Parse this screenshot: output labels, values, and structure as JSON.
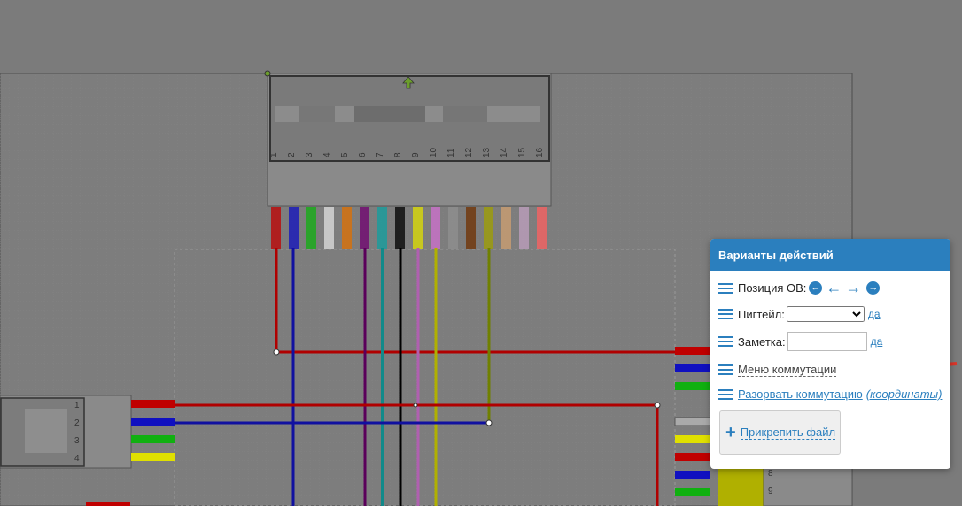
{
  "popup": {
    "title": "Варианты действий",
    "position_label": "Позиция ОВ:",
    "pigtail_label": "Пигтейл:",
    "pigtail_selected": "",
    "pigtail_confirm": "да",
    "note_label": "Заметка:",
    "note_value": "",
    "note_confirm": "да",
    "switch_menu": "Меню коммутации",
    "break_switch": "Разорвать коммутацию",
    "coords": "(координаты)",
    "attach_file": "Прикрепить файл"
  },
  "connector_top": {
    "ports": [
      "1",
      "2",
      "3",
      "4",
      "5",
      "6",
      "7",
      "8",
      "9",
      "10",
      "11",
      "12",
      "13",
      "14",
      "15",
      "16"
    ],
    "fiber_colors": [
      "#c00000",
      "#1010c0",
      "#10b010",
      "#e0e0e0",
      "#e07000",
      "#700070",
      "#10a0a0",
      "#000000",
      "#e0e000",
      "#d070d0",
      "#909090",
      "#703000",
      "#a0a000",
      "#d0a070",
      "#c0a0c0",
      "#ff6060"
    ]
  },
  "connector_left": {
    "ports": [
      "1",
      "2",
      "3",
      "4"
    ]
  },
  "connector_right": {
    "ports": [
      "8",
      "9"
    ]
  }
}
